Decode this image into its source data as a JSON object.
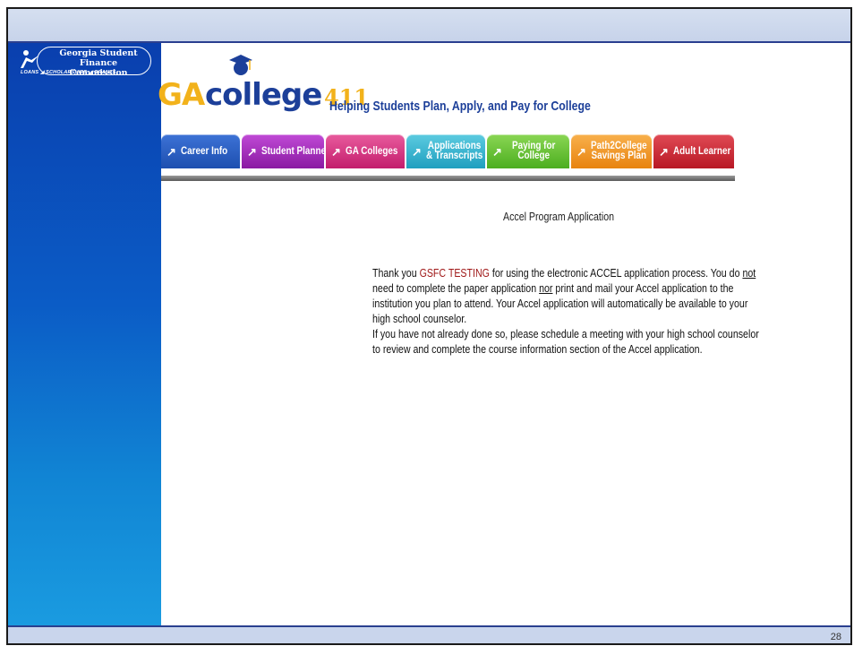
{
  "logo": {
    "line1": "Georgia Student",
    "line2": "Finance Commission",
    "tagline": "LOANS ◢ SCHOLARSHIPS ◢ GRANTS"
  },
  "brand": {
    "ga": "GA",
    "college": "college",
    "num": "411",
    "tagline": "Helping Students Plan, Apply, and Pay for College"
  },
  "tabs": [
    {
      "label": "Career Info",
      "color": "#1d4fb0"
    },
    {
      "label": "Student Planner",
      "color": "#9d1fb5"
    },
    {
      "label": "GA Colleges",
      "color": "#d3257a"
    },
    {
      "label_line1": "Applications",
      "label_line2": "& Transcripts",
      "color": "#2aa9c8"
    },
    {
      "label_line1": "Paying for",
      "label_line2": "College",
      "color": "#5fbf2c"
    },
    {
      "label_line1": "Path2College",
      "label_line2": "Savings Plan",
      "color": "#f0921c"
    },
    {
      "label": "Adult Learner",
      "color": "#c5202e"
    }
  ],
  "main": {
    "heading": "Accel Program Application",
    "thank_you": "Thank you",
    "user_name": "GSFC TESTING",
    "p1_a": "for using the electronic ACCEL application process. You do",
    "not": "not",
    "p1_b": "need to complete the paper application",
    "nor": "nor",
    "p1_c": "print and mail your Accel application to the institution you plan to attend. Your Accel application will automatically be available to your high school counselor.",
    "p2": "If you have not already done so, please schedule a meeting with your high school counselor to review and complete the course information section of the Accel application."
  },
  "slide_number": "28"
}
